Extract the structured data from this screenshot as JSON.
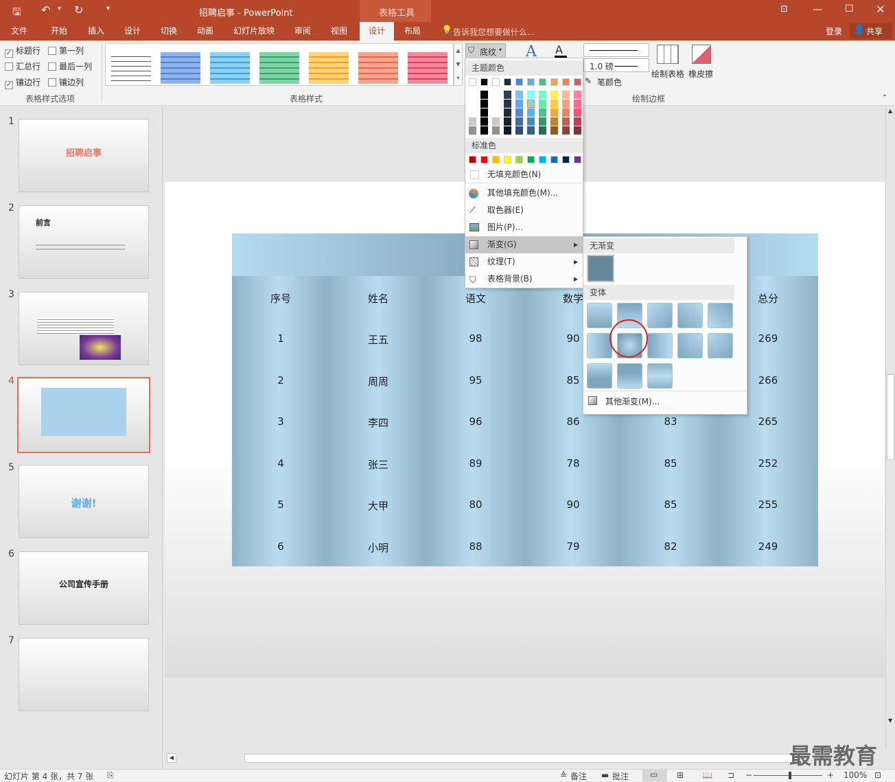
{
  "titlebar": {
    "title": "招聘启事 - PowerPoint",
    "context_tab": "表格工具",
    "save_icon": "save-icon",
    "undo_icon": "undo-icon",
    "redo_icon": "redo-icon"
  },
  "tabs": [
    "文件",
    "开始",
    "插入",
    "设计",
    "切换",
    "动画",
    "幻灯片放映",
    "审阅",
    "视图",
    "设计",
    "布局"
  ],
  "tellme": "告诉我您想要做什么...",
  "login": "登录",
  "share": "共享",
  "ribbon": {
    "options": {
      "header_row": "标题行",
      "total_row": "汇总行",
      "banded_rows": "镶边行",
      "first_col": "第一列",
      "last_col": "最后一列",
      "banded_cols": "镶边列"
    },
    "options_label": "表格样式选项",
    "styles_label": "表格样式",
    "shading": "底纹",
    "pen_weight": "1.0 磅",
    "pen_color": "笔颜色",
    "draw_table": "绘制表格",
    "eraser": "橡皮擦",
    "borders_label": "绘制边框",
    "style_colors": [
      "#ffffff",
      "#8cb4ea",
      "#8fd0f0",
      "#82d4a8",
      "#ffd27a",
      "#f5a58f",
      "#f1899b"
    ]
  },
  "menu": {
    "theme_colors": "主题颜色",
    "standard_colors": "标准色",
    "no_fill": "无填充颜色(N)",
    "more_fill": "其他填充颜色(M)...",
    "eyedropper": "取色器(E)",
    "picture": "图片(P)...",
    "gradient": "渐变(G)",
    "texture": "纹理(T)",
    "table_bg": "表格背景(B)",
    "standard": [
      "#c00000",
      "#ff0000",
      "#ffc000",
      "#ffff00",
      "#92d050",
      "#00b050",
      "#00b0f0",
      "#0070c0",
      "#002060",
      "#7030a0"
    ],
    "theme_top": [
      "#ffffff",
      "#000000",
      "#ffffff",
      "#1f2b3e",
      "#4f86d4",
      "#5ab0e6",
      "#4bc08b",
      "#f6a539",
      "#f07f63",
      "#e8566f"
    ]
  },
  "submenu": {
    "no_gradient": "无渐变",
    "variants": "变体",
    "more_gradients": "其他渐变(M)..."
  },
  "table": {
    "headers": [
      "序号",
      "姓名",
      "语文",
      "数学",
      "",
      "总分"
    ],
    "rows": [
      [
        "1",
        "王五",
        "98",
        "90",
        "",
        "269"
      ],
      [
        "2",
        "周周",
        "95",
        "85",
        "",
        "266"
      ],
      [
        "3",
        "李四",
        "96",
        "86",
        "83",
        "265"
      ],
      [
        "4",
        "张三",
        "89",
        "78",
        "85",
        "252"
      ],
      [
        "5",
        "大甲",
        "80",
        "90",
        "85",
        "255"
      ],
      [
        "6",
        "小明",
        "88",
        "79",
        "82",
        "249"
      ]
    ]
  },
  "thumbs": [
    {
      "num": "1",
      "title": "招聘启事"
    },
    {
      "num": "2",
      "title": "前言"
    },
    {
      "num": "3",
      "title": ""
    },
    {
      "num": "4",
      "title": ""
    },
    {
      "num": "5",
      "title": "谢谢!"
    },
    {
      "num": "6",
      "title": "公司宣传手册"
    },
    {
      "num": "7",
      "title": ""
    }
  ],
  "status": {
    "slide_info": "幻灯片 第 4 张，共 7 张",
    "notes": "备注",
    "comments": "批注",
    "zoom": "100%"
  },
  "watermark": "最需教育"
}
